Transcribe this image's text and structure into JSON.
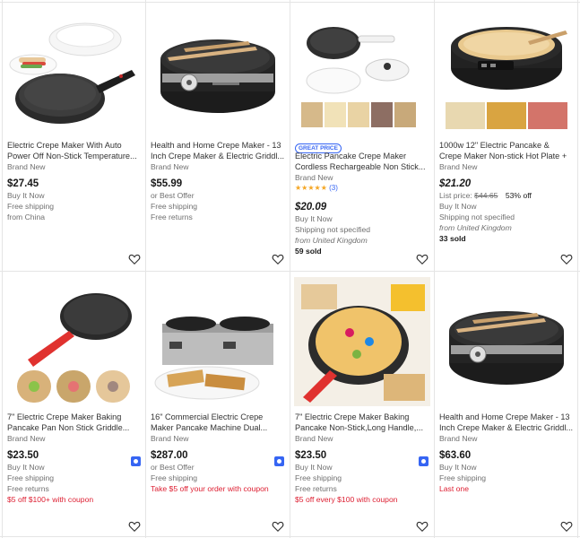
{
  "listings": [
    {
      "title": "Electric Crepe Maker With Auto Power Off Non-Stick Temperature...",
      "condition": "Brand New",
      "price": "$27.45",
      "lines": [
        "Buy It Now",
        "Free shipping",
        "from China"
      ]
    },
    {
      "title": "Health and Home Crepe Maker - 13 Inch Crepe Maker & Electric Griddl...",
      "condition": "Brand New",
      "price": "$55.99",
      "lines": [
        "or Best Offer",
        "Free shipping",
        "Free returns"
      ]
    },
    {
      "badge": "GREAT PRICE",
      "title": "Electric Pancake Crepe Maker Cordless Rechargeable Non Stick...",
      "condition": "Brand New",
      "rating_count": "(3)",
      "price": "$20.09",
      "lines": [
        "Buy It Now",
        "Shipping not specified",
        "from United Kingdom",
        "59 sold"
      ]
    },
    {
      "title": "1000w 12\" Electric Pancake & Crepe Maker Non-stick Hot Plate + Free...",
      "condition": "Brand New",
      "price": "$21.20",
      "list_price_label": "List price:",
      "list_price": "$44.65",
      "discount": "53% off",
      "lines": [
        "Buy It Now",
        "Shipping not specified",
        "from United Kingdom",
        "33 sold"
      ]
    },
    {
      "title": "7\" Electric Crepe Maker Baking Pancake Pan Non Stick Griddle...",
      "condition": "Brand New",
      "price": "$23.50",
      "lines": [
        "Buy It Now",
        "Free shipping",
        "Free returns"
      ],
      "promo": "$5 off $100+ with coupon"
    },
    {
      "title": "16\" Commercial Electric Crepe Maker Pancake Machine Dual...",
      "condition": "Brand New",
      "price": "$287.00",
      "lines": [
        "or Best Offer",
        "Free shipping"
      ],
      "promo": "Take $5 off your order with coupon"
    },
    {
      "title": "7\" Electric Crepe Maker Baking Pancake Non-Stick,Long Handle,...",
      "condition": "Brand New",
      "price": "$23.50",
      "lines": [
        "Buy It Now",
        "Free shipping",
        "Free returns"
      ],
      "promo": "$5 off every $100 with coupon"
    },
    {
      "title": "Health and Home Crepe Maker - 13 Inch Crepe Maker & Electric Griddl...",
      "condition": "Brand New",
      "price": "$63.60",
      "lines": [
        "Buy It Now",
        "Free shipping"
      ],
      "promo": "Last one"
    }
  ],
  "colors": {
    "accent": "#3665f3",
    "promo": "#dd1e31",
    "muted": "#707070"
  }
}
